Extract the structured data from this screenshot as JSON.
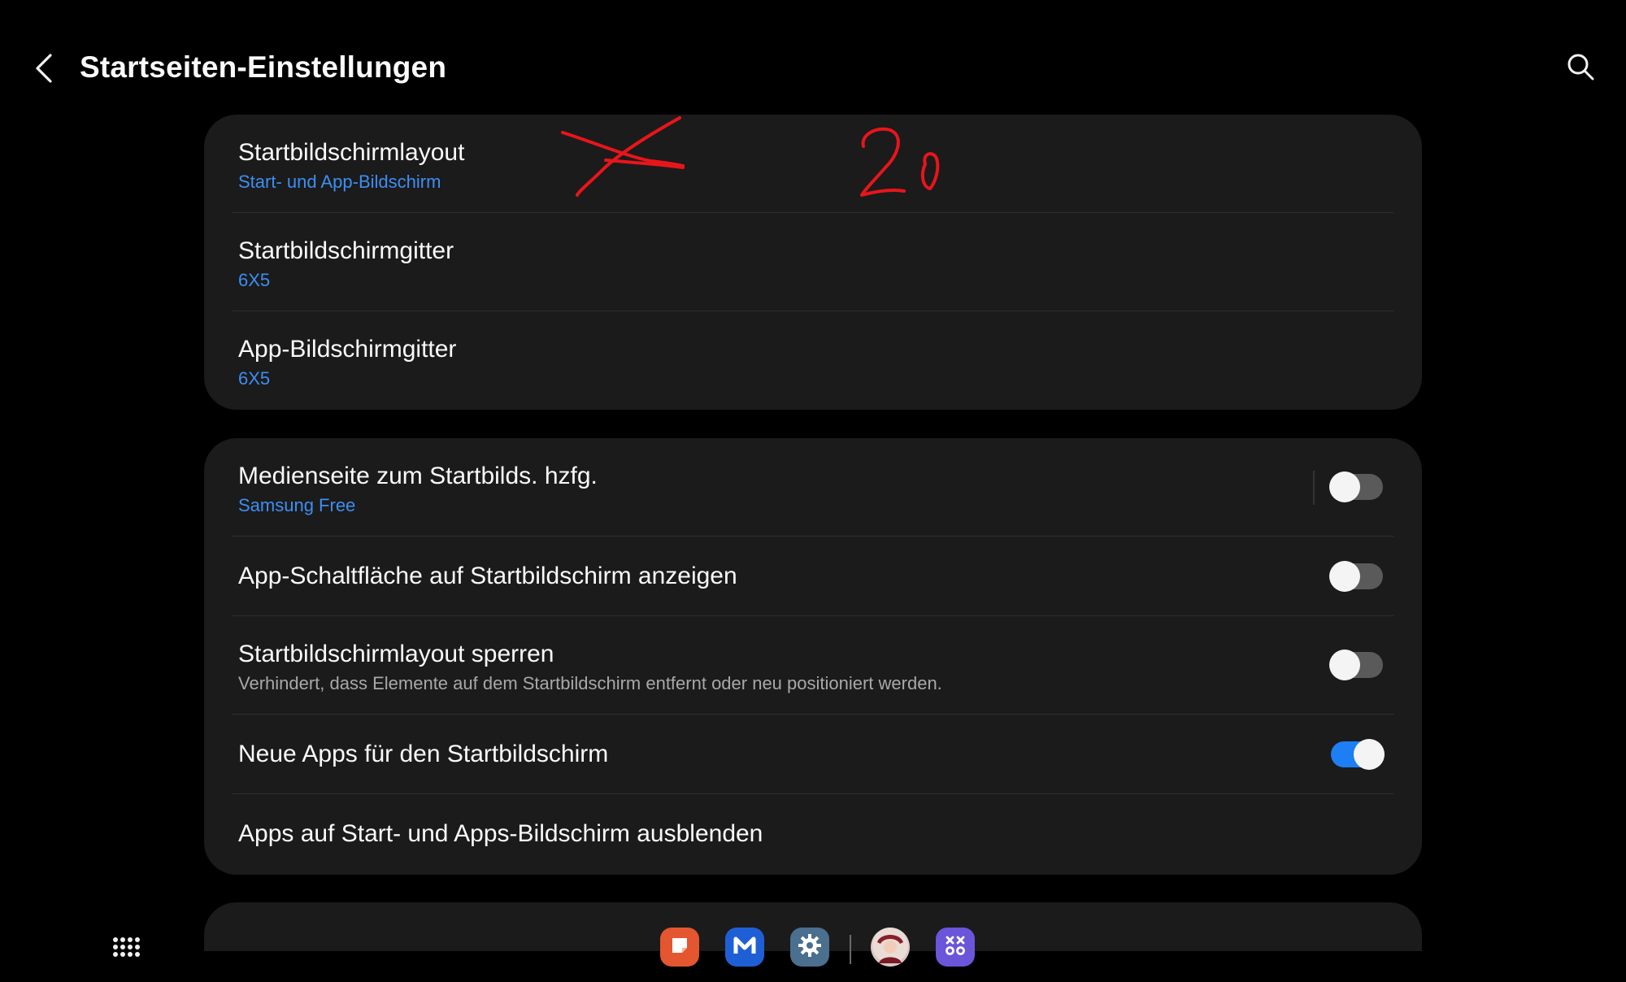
{
  "header": {
    "title": "Startseiten-Einstellungen",
    "back_icon": "chevron-left-icon",
    "search_icon": "search-icon"
  },
  "group1": {
    "items": [
      {
        "title": "Startbildschirmlayout",
        "subtitle": "Start- und App-Bildschirm"
      },
      {
        "title": "Startbildschirmgitter",
        "subtitle": "6X5"
      },
      {
        "title": "App-Bildschirmgitter",
        "subtitle": "6X5"
      }
    ]
  },
  "group2": {
    "items": [
      {
        "title": "Medienseite zum Startbilds. hzfg.",
        "subtitle": "Samsung Free",
        "toggle": false
      },
      {
        "title": "App-Schaltfläche auf Startbildschirm anzeigen",
        "toggle": false
      },
      {
        "title": "Startbildschirmlayout sperren",
        "description": "Verhindert, dass Elemente auf dem Startbildschirm entfernt oder neu positioniert werden.",
        "toggle": false
      },
      {
        "title": "Neue Apps für den Startbildschirm",
        "toggle": true
      },
      {
        "title": "Apps auf Start- und Apps-Bildschirm ausblenden"
      }
    ]
  },
  "handwritten_annotation": "2 0",
  "taskbar": {
    "apps_button_icon": "apps-grid-icon",
    "dock_apps": [
      {
        "name": "notes-app-icon",
        "color": "#e3562f"
      },
      {
        "name": "m-app-icon",
        "color": "#1f5fd6"
      },
      {
        "name": "settings-gear-icon",
        "color": "#4a6f8f"
      },
      {
        "name": "contact-avatar-icon",
        "color": "#d9c7c0"
      },
      {
        "name": "game-launcher-icon",
        "color": "#6b55d9"
      }
    ]
  },
  "colors": {
    "background": "#000000",
    "card": "#1b1b1b",
    "accent_blue": "#3d8ef3",
    "toggle_on": "#1e7ef4",
    "annotation_red": "#e8151b"
  }
}
